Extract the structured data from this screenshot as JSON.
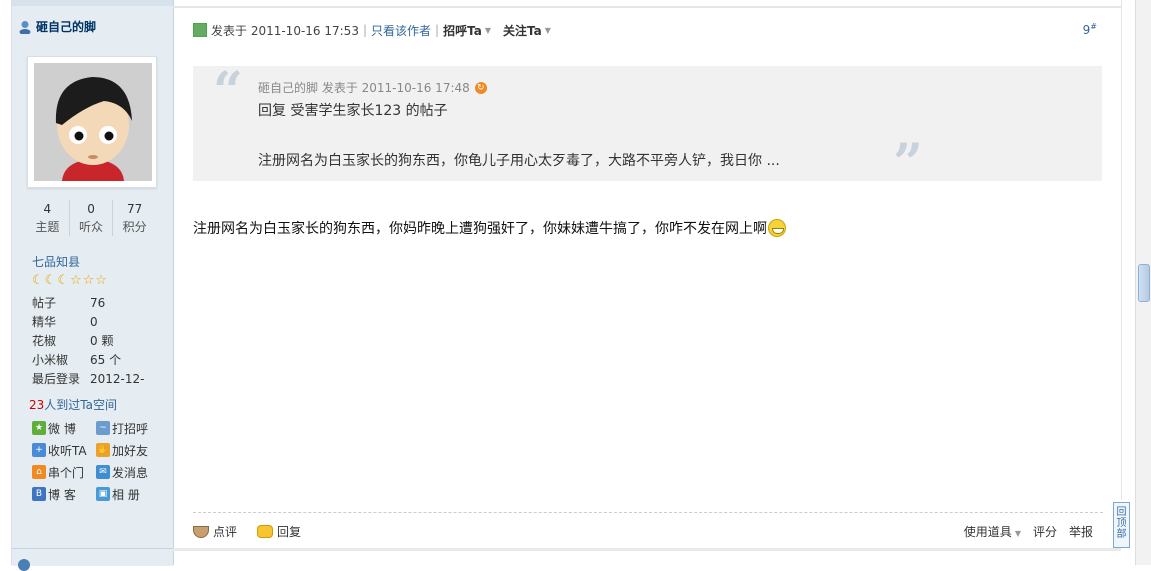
{
  "sidebar": {
    "username": "砸自己的脚",
    "stats": [
      {
        "num": "4",
        "label": "主题"
      },
      {
        "num": "0",
        "label": "听众"
      },
      {
        "num": "77",
        "label": "积分"
      }
    ],
    "rank": "七品知县",
    "info": [
      {
        "k": "帖子",
        "v": "76"
      },
      {
        "k": "精华",
        "v": "0"
      },
      {
        "k": "花椒",
        "v": "0 颗"
      },
      {
        "k": "小米椒",
        "v": "65 个"
      },
      {
        "k": "最后登录",
        "v": "2012-12-"
      }
    ],
    "visited_count": "23",
    "visited_text": "人到过Ta空间",
    "actions": [
      {
        "label": "微 博",
        "icon": "weibo-icon",
        "color": "#5fae3a"
      },
      {
        "label": "打招呼",
        "icon": "wave-icon",
        "color": "#6c9bd0"
      },
      {
        "label": "收听TA",
        "icon": "listen-icon",
        "color": "#4a8ad6"
      },
      {
        "label": "加好友",
        "icon": "handshake-icon",
        "color": "#e9a22c"
      },
      {
        "label": "串个门",
        "icon": "home-icon",
        "color": "#f08a24"
      },
      {
        "label": "发消息",
        "icon": "mail-icon",
        "color": "#3e8ed0"
      },
      {
        "label": "博 客",
        "icon": "blog-icon",
        "color": "#3e74c0"
      },
      {
        "label": "相 册",
        "icon": "album-icon",
        "color": "#4a9ad8"
      }
    ]
  },
  "post": {
    "posted_at": "发表于 2011-10-16 17:53",
    "only_author": "只看该作者",
    "greet": "招呼Ta",
    "follow": "关注Ta",
    "floor": "9",
    "floor_mark": "#",
    "quote": {
      "meta": "砸自己的脚 发表于 2011-10-16 17:48",
      "reply_to": "回复 受害学生家长123 的帖子",
      "text": "注册网名为白玉家长的狗东西，你龟儿子用心太歹毒了，大路不平旁人铲，我日你 ..."
    },
    "body": "注册网名为白玉家长的狗东西，你妈昨晚上遭狗强奸了，你妹妹遭牛搞了，你咋不发在网上啊",
    "footer": {
      "comment": "点评",
      "reply": "回复",
      "tools": "使用道具",
      "rate": "评分",
      "report": "举报"
    }
  },
  "backtop": "回顶部"
}
